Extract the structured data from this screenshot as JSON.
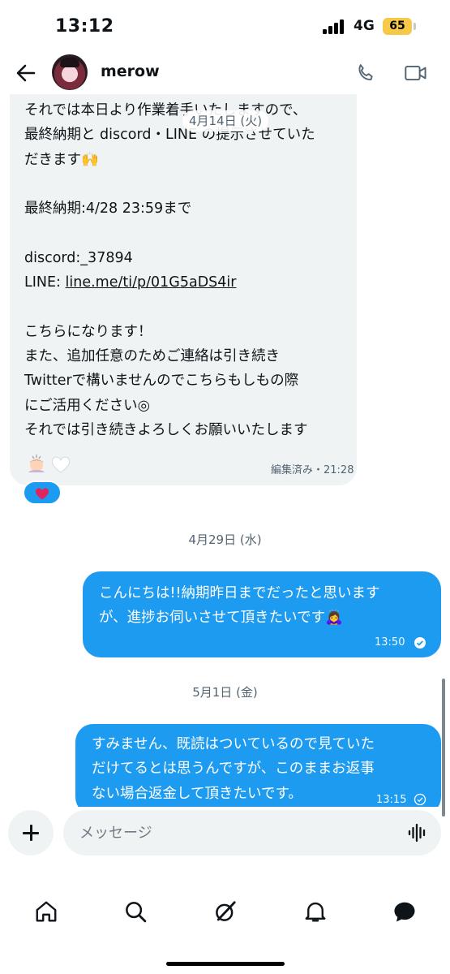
{
  "status_bar": {
    "time": "13:12",
    "network": "4G",
    "battery": "65"
  },
  "header": {
    "username": "merow",
    "icons": [
      "back-arrow-icon",
      "phone-icon",
      "video-icon"
    ]
  },
  "messages": {
    "incoming": {
      "text_lines": [
        "それでは本日より作業着手いたしますので、",
        "最終納期と discord・LINE の提示させていた",
        "だきます🙌",
        "",
        "最終納期:4/28 23:59まで",
        "",
        "discord:_37894",
        "LINE: line.me/ti/p/01G5aDS4ir",
        "",
        "こちらになります！",
        "また、追加任意のためご連絡は引き続き",
        "Twitterで構いませんのでこちらもしもの際",
        "にご活用ください◎",
        "それでは引き続きよろしくお願いいたします"
      ],
      "link": "line.me/ti/p/01G5aDS4ir",
      "meta": "編集済み・21:28",
      "reaction": "heart"
    },
    "floating_date": "4月14日 (火)",
    "date_1": "4月29日 (水)",
    "outgoing_1": {
      "text": "こんにちは!!納期昨日までだったと思います\nが、進捗お伺いさせて頂きたいです🙇‍♀️",
      "time": "13:50"
    },
    "date_2": "5月1日 (金)",
    "outgoing_2": {
      "text": "すみません、既読はついているので見ていた\nだけてるとは思うんですが、このままお返事\nない場合返金して頂きたいです。",
      "time": "13:15"
    }
  },
  "composer": {
    "placeholder": "メッセージ"
  },
  "nav": [
    "home-icon",
    "search-icon",
    "grok-icon",
    "notifications-icon",
    "messages-icon"
  ],
  "colors": {
    "accent": "#1d9bf0",
    "bubble_in": "#eff3f4",
    "text": "#0f1419",
    "muted": "#536471"
  }
}
